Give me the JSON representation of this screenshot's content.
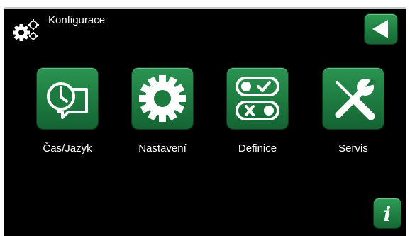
{
  "header": {
    "title": "Konfigurace",
    "icon": "gears-icon"
  },
  "nav": {
    "back_icon": "back-arrow-icon",
    "info_icon": "info-icon",
    "info_glyph": "i"
  },
  "menu": [
    {
      "label": "Čas/Jazyk",
      "icon": "clock-speech-icon"
    },
    {
      "label": "Nastavení",
      "icon": "gear-icon"
    },
    {
      "label": "Definice",
      "icon": "toggle-switches-icon"
    },
    {
      "label": "Servis",
      "icon": "wrench-screwdriver-icon"
    }
  ],
  "colors": {
    "background": "#000000",
    "accent_green": "#1f7e41",
    "text": "#ffffff"
  }
}
